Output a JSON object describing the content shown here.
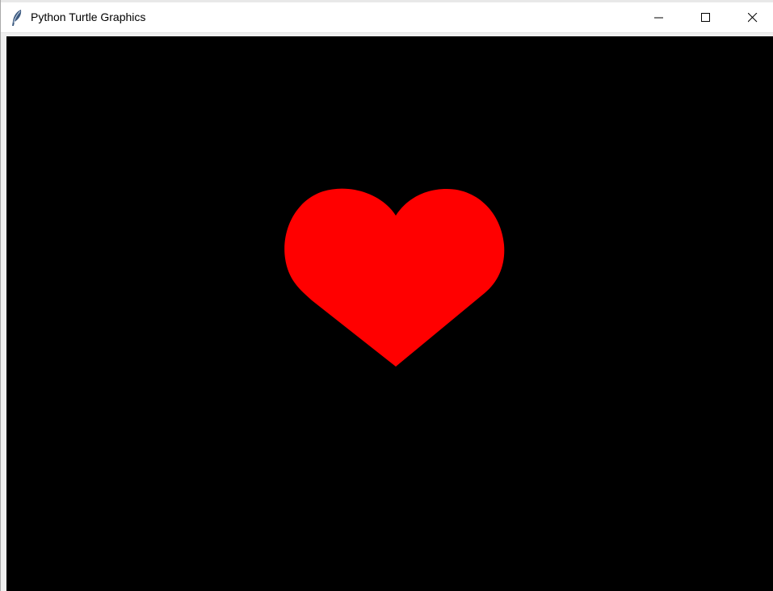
{
  "window": {
    "title": "Python Turtle Graphics",
    "app_icon": "feather-icon",
    "controls": {
      "minimize": "minimize-icon",
      "maximize": "maximize-icon",
      "close": "close-icon"
    }
  },
  "canvas": {
    "background_color": "#000000",
    "shape": {
      "type": "heart",
      "fill_color": "#ff0000"
    }
  }
}
